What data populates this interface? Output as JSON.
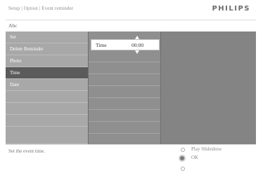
{
  "header": {
    "breadcrumb": "Setup | Option | Event reminder",
    "brand": "PHILIPS"
  },
  "title": "Abc",
  "menu": {
    "items": [
      {
        "label": "Set",
        "selected": false
      },
      {
        "label": "Delete Reminder",
        "selected": false
      },
      {
        "label": "Photo",
        "selected": false
      },
      {
        "label": "Time",
        "selected": true
      },
      {
        "label": "Date",
        "selected": false
      }
    ]
  },
  "time_field": {
    "label": "Time",
    "value": "00:00"
  },
  "status": {
    "hint": "Set the event time.",
    "play_label": "Play Slideshow",
    "ok_label": "OK"
  },
  "colors": {
    "panel": "#848484",
    "menu_item": "#a8a8a8",
    "menu_selected": "#5b5b5b"
  }
}
